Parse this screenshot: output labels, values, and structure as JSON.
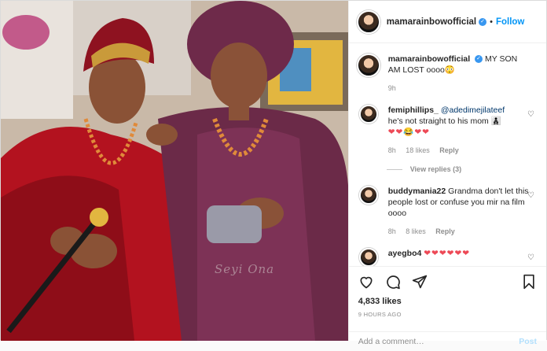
{
  "header": {
    "username": "mamarainbowofficial",
    "separator": "•",
    "follow_label": "Follow"
  },
  "caption": {
    "username": "mamarainbowofficial",
    "text": "MY SON AM LOST oooo😳",
    "time": "9h"
  },
  "comments": [
    {
      "username": "femiphillips_",
      "mention": "@adedimejilateef",
      "text": "he's not straight to his mom 👨‍👦‍👦",
      "emoji": "❤❤😂❤❤",
      "time": "8h",
      "likes": "18 likes",
      "reply_label": "Reply",
      "view_replies": "View replies (3)"
    },
    {
      "username": "buddymania22",
      "text": "Grandma don't let this people lost or confuse you mir na film oooo",
      "time": "8h",
      "likes": "8 likes",
      "reply_label": "Reply"
    },
    {
      "username": "ayegbo4",
      "text": "❤❤❤❤❤❤"
    }
  ],
  "actions": {
    "likes": "4,833 likes",
    "time_ago": "9 HOURS AGO"
  },
  "add_comment": {
    "placeholder": "Add a comment…",
    "post_label": "Post"
  },
  "photo": {
    "watermark": "Seyi Ona"
  }
}
